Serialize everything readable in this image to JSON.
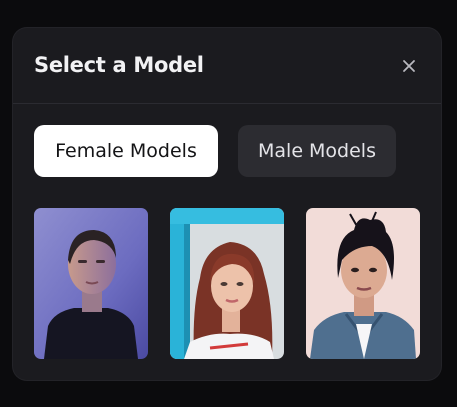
{
  "modal": {
    "title": "Select a Model",
    "close_icon": "close-icon"
  },
  "tabs": [
    {
      "label": "Female Models",
      "selected": true
    },
    {
      "label": "Male Models",
      "selected": false
    }
  ],
  "models": [
    {
      "id": "model-1",
      "thumbnail": "portrait"
    },
    {
      "id": "model-2",
      "thumbnail": "portrait"
    },
    {
      "id": "model-3",
      "thumbnail": "portrait"
    }
  ],
  "colors": {
    "modal_background": "#1b1b1f",
    "tab_selected_background": "#ffffff",
    "tab_unselected_background": "#2c2c31",
    "title_text": "#f2f2f4"
  }
}
